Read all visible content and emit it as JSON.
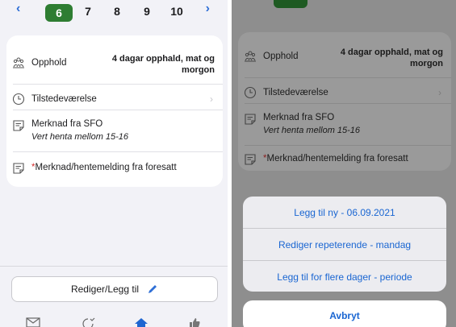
{
  "left": {
    "date_strip": {
      "prev_icon": "chevron-left-icon",
      "next_icon": "chevron-right-icon",
      "days": [
        "6",
        "7",
        "8",
        "9",
        "10"
      ],
      "selected_day": "6"
    },
    "rows": {
      "opphold_label": "Opphold",
      "opphold_value": "4 dagar opphald, mat og morgon",
      "tilstede_label": "Tilstedeværelse",
      "merknad_label": "Merknad fra SFO",
      "merknad_text": "Vert henta mellom 15-16",
      "foresatt_required": "*",
      "foresatt_label": "Merknad/hentemelding fra foresatt"
    },
    "edit_button_label": "Rediger/Legg til",
    "accent_color": "#2e7d32",
    "link_color": "#2f6fd6"
  },
  "right": {
    "rows": {
      "opphold_label": "Opphold",
      "opphold_value": "4 dagar opphald, mat og morgon",
      "tilstede_label": "Tilstedeværelse",
      "merknad_label": "Merknad fra SFO",
      "merknad_text": "Vert henta mellom 15-16",
      "foresatt_required": "*",
      "foresatt_label": "Merknad/hentemelding fra foresatt"
    },
    "action_sheet": {
      "items": [
        "Legg til ny - 06.09.2021",
        "Rediger repeterende - mandag",
        "Legg til for flere dager - periode"
      ],
      "cancel_label": "Avbryt"
    }
  }
}
